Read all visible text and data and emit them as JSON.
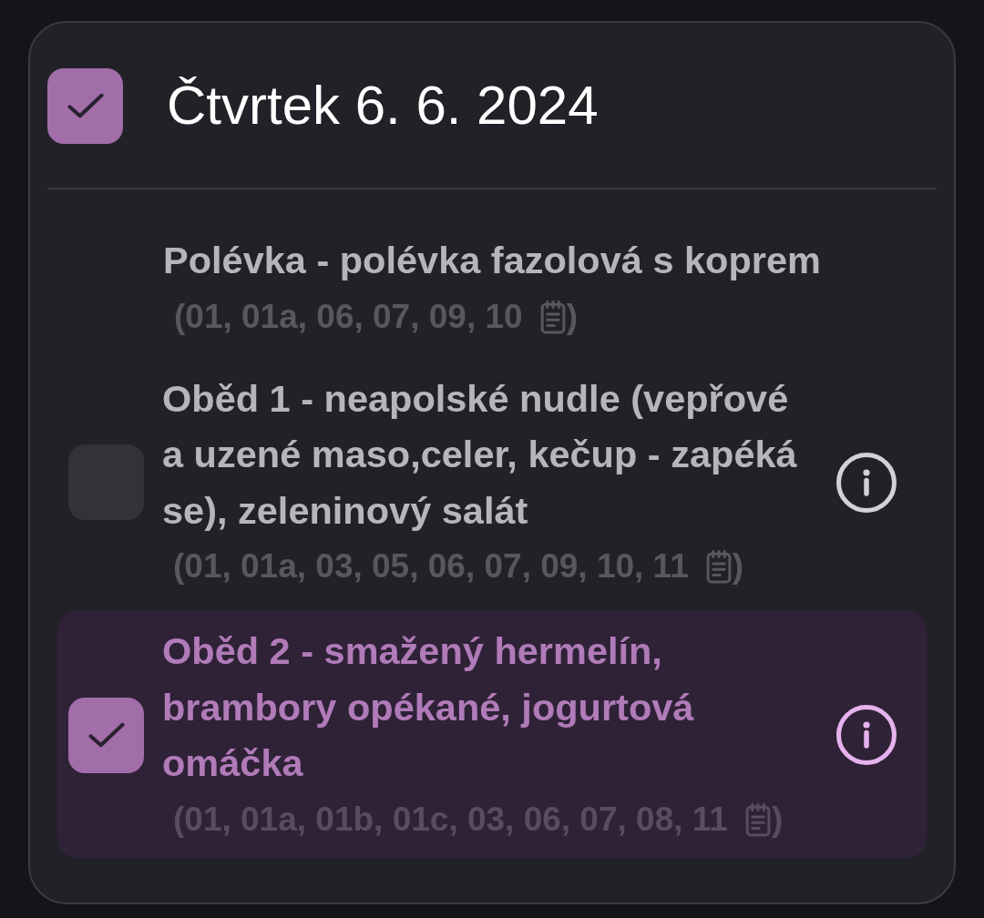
{
  "day": {
    "title": "Čtvrtek 6. 6. 2024",
    "checked": true
  },
  "soup": {
    "name": "Polévka - polévka fazolová s koprem",
    "allergens": "(01, 01a, 06, 07, 09, 10",
    "allergens_close": ")"
  },
  "meals": [
    {
      "name": "Oběd 1 - neapolské nudle (vepřové a uzené maso,celer, kečup - zapéká se), zeleninový salát",
      "allergens": "(01, 01a, 03, 05, 06, 07, 09, 10, 11",
      "allergens_close": ")",
      "selected": false
    },
    {
      "name": "Oběd 2 - smažený hermelín, brambory opékané, jogurtová omáčka",
      "allergens": "(01, 01a, 01b, 01c, 03, 06, 07, 08, 11",
      "allergens_close": ")",
      "selected": true
    }
  ]
}
